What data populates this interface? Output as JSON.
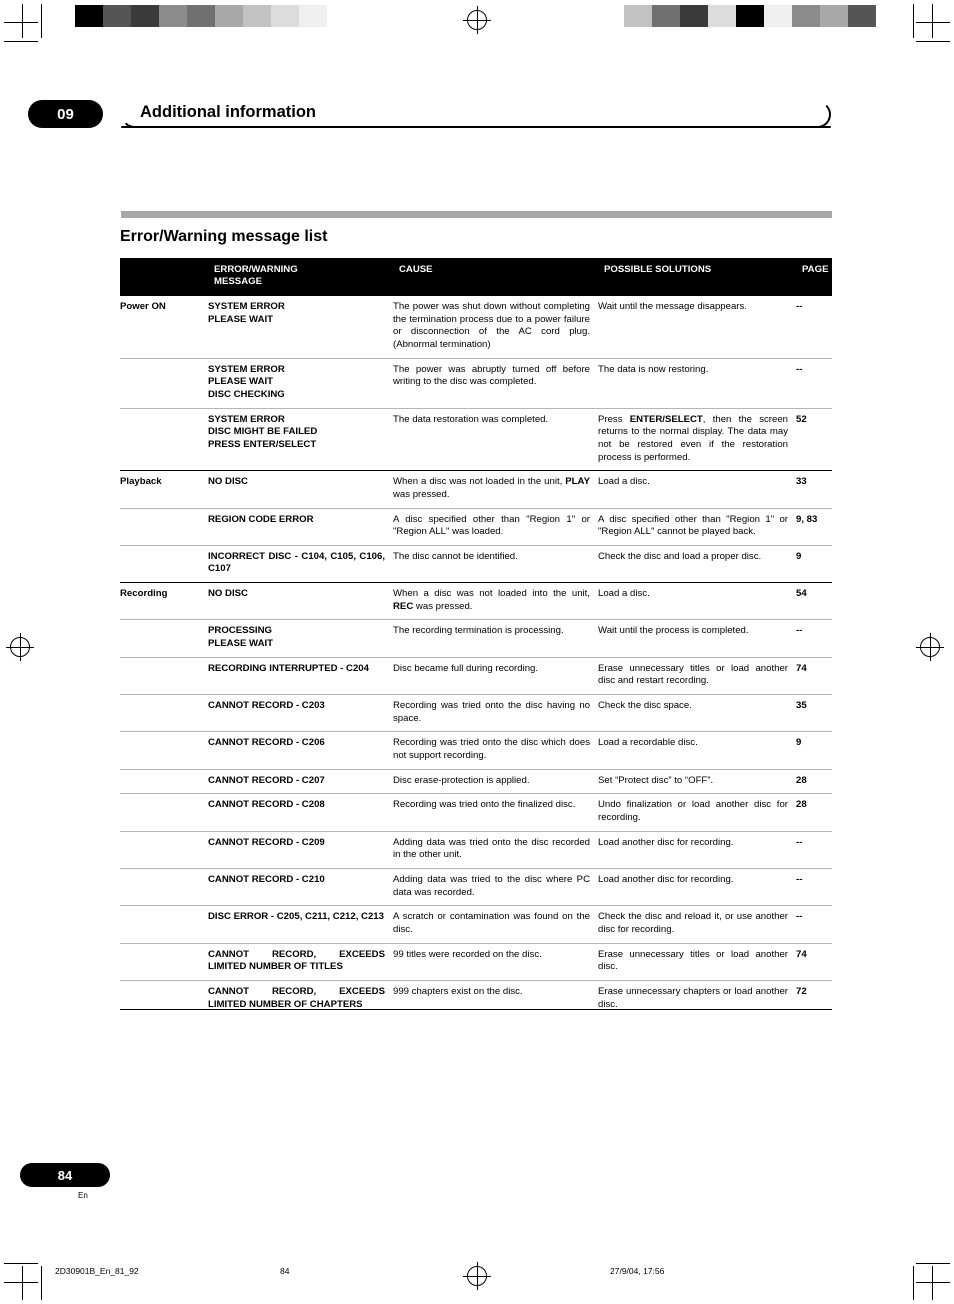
{
  "header": {
    "chapter_number": "09",
    "chapter_title": "Additional information"
  },
  "section": {
    "title": "Error/Warning message list"
  },
  "table": {
    "columns": [
      "",
      "ERROR/WARNING MESSAGE",
      "CAUSE",
      "POSSIBLE SOLUTIONS",
      "PAGE"
    ],
    "col_header_msg_line1": "ERROR/WARNING",
    "col_header_msg_line2": "MESSAGE",
    "col_header_cause": "CAUSE",
    "col_header_solutions": "POSSIBLE SOLUTIONS",
    "col_header_page": "PAGE",
    "rows": [
      {
        "group": "Power ON",
        "message": "SYSTEM ERROR\nPLEASE WAIT",
        "cause": "The power was shut down without completing the termination process due to a power failure or disconnection of the AC cord plug. (Abnormal termination)",
        "solution": "Wait until the message disappears.",
        "page": "--"
      },
      {
        "group": "",
        "message": "SYSTEM ERROR\nPLEASE WAIT\nDISC CHECKING",
        "cause": "The power was abruptly turned off before writing to the disc was completed.",
        "solution": "The data is now restoring.",
        "page": "--"
      },
      {
        "group": "",
        "message": "SYSTEM ERROR\nDISC MIGHT BE FAILED\nPRESS ENTER/SELECT",
        "cause": "The data restoration was completed.",
        "solution": "Press ENTER/SELECT, then the screen returns to the normal display. The data may not be restored even if the restoration process is performed.",
        "solution_bold": "ENTER/SELECT",
        "page": "52"
      },
      {
        "group": "Playback",
        "message": "NO DISC",
        "cause": "When a disc was not loaded in the unit, PLAY was pressed.",
        "cause_bold": "PLAY",
        "solution": "Load a disc.",
        "page": "33"
      },
      {
        "group": "",
        "message": "REGION CODE ERROR",
        "cause": "A disc specified other than \"Region 1\" or \"Region ALL\" was loaded.",
        "solution": "A disc specified other than \"Region 1\" or \"Region ALL\" cannot be played back.",
        "page": "9, 83"
      },
      {
        "group": "",
        "message": "INCORRECT DISC - C104, C105, C106, C107",
        "cause": "The disc cannot be identified.",
        "solution": "Check the disc and load a proper disc.",
        "page": "9"
      },
      {
        "group": "Recording",
        "message": "NO DISC",
        "cause": "When a disc was not loaded into the unit, REC was pressed.",
        "cause_bold": "REC",
        "solution": "Load a disc.",
        "page": "54"
      },
      {
        "group": "",
        "message": "PROCESSING\nPLEASE WAIT",
        "cause": "The recording termination is processing.",
        "solution": "Wait until the process is completed.",
        "page": "--"
      },
      {
        "group": "",
        "message": "RECORDING INTERRUPTED - C204",
        "cause": "Disc became full during recording.",
        "solution": "Erase unnecessary titles or load another disc and restart recording.",
        "page": "74"
      },
      {
        "group": "",
        "message": "CANNOT RECORD  - C203",
        "cause": "Recording was tried onto the disc having no space.",
        "solution": "Check the disc space.",
        "page": "35"
      },
      {
        "group": "",
        "message": "CANNOT RECORD  - C206",
        "cause": "Recording was tried onto the disc which does not support recording.",
        "solution": "Load a recordable disc.",
        "page": "9"
      },
      {
        "group": "",
        "message": "CANNOT RECORD  - C207",
        "cause": "Disc erase-protection is applied.",
        "solution": "Set “Protect disc”  to “OFF”.",
        "page": "28"
      },
      {
        "group": "",
        "message": "CANNOT RECORD  - C208",
        "cause": "Recording was tried onto the finalized disc.",
        "solution": "Undo finalization or load another disc for recording.",
        "page": "28"
      },
      {
        "group": "",
        "message": "CANNOT RECORD  - C209",
        "cause": "Adding data was tried onto the disc recorded in the other unit.",
        "solution": "Load another disc for recording.",
        "page": "--"
      },
      {
        "group": "",
        "message": "CANNOT RECORD  - C210",
        "cause": "Adding data was tried to the disc where PC data was recorded.",
        "solution": "Load another disc for recording.",
        "page": "--"
      },
      {
        "group": "",
        "message": "DISC ERROR - C205, C211, C212, C213",
        "cause": "A scratch or contamination was found on the disc.",
        "solution": "Check the disc and reload it, or use another disc for recording.",
        "page": "--"
      },
      {
        "group": "",
        "message": "CANNOT RECORD, EXCEEDS LIMITED NUMBER OF TITLES",
        "cause": "99 titles were recorded on the disc.",
        "solution": "Erase unnecessary titles or load another disc.",
        "page": "74"
      },
      {
        "group": "",
        "message": "CANNOT RECORD, EXCEEDS LIMITED NUMBER OF CHAPTERS",
        "cause": "999 chapters exist on the disc.",
        "solution": "Erase unnecessary chapters or load another disc.",
        "page": "72"
      }
    ]
  },
  "footer": {
    "page_number": "84",
    "language": "En",
    "file_code": "2D30901B_En_81_92",
    "page_label": "84",
    "timestamp": "27/9/04, 17:56"
  }
}
